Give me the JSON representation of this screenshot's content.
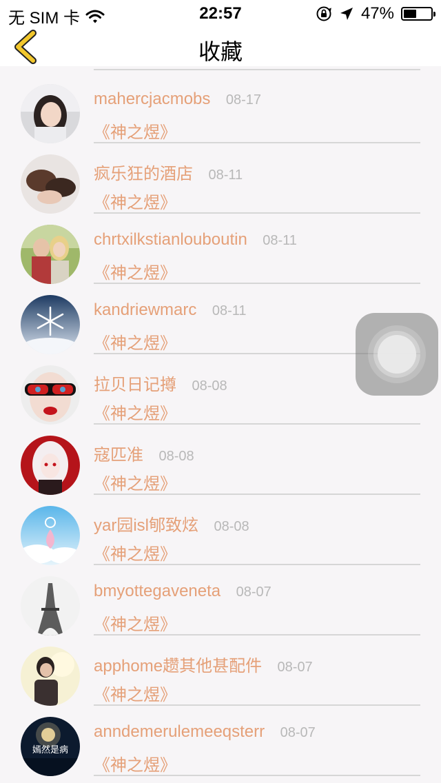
{
  "status_bar": {
    "carrier": "无 SIM 卡",
    "time": "22:57",
    "battery_text": "47%",
    "battery_level": 0.47,
    "icons": [
      "wifi-icon",
      "rotation-lock-icon",
      "location-arrow-icon",
      "battery-icon"
    ]
  },
  "nav": {
    "title": "收藏",
    "back_icon": "chevron-left-icon",
    "accent_color": "#f2c72c"
  },
  "colors": {
    "name": "#e5a078",
    "date": "#b8b8b8",
    "divider": "#d6d6d6",
    "background": "#f7f5f7"
  },
  "favorites": [
    {
      "name": "",
      "date": "",
      "book": ""
    },
    {
      "name": "mahercjacmobs",
      "date": "08-17",
      "book": "《神之煜》"
    },
    {
      "name": "疯乐狂的酒店",
      "date": "08-11",
      "book": "《神之煜》"
    },
    {
      "name": "chrtxilkstianlouboutin",
      "date": "08-11",
      "book": "《神之煜》"
    },
    {
      "name": "kandriewmarc",
      "date": "08-11",
      "book": "《神之煜》"
    },
    {
      "name": "拉贝日记撙",
      "date": "08-08",
      "book": "《神之煜》"
    },
    {
      "name": "寇匹准",
      "date": "08-08",
      "book": "《神之煜》"
    },
    {
      "name": "yar园isl郇致炫",
      "date": "08-08",
      "book": "《神之煜》"
    },
    {
      "name": "bmyottegaveneta",
      "date": "08-07",
      "book": "《神之煜》"
    },
    {
      "name": "apphome趱其他甚配件",
      "date": "08-07",
      "book": "《神之煜》"
    },
    {
      "name": "anndemerulemeeqsterr",
      "date": "08-07",
      "book": "《神之煜》"
    }
  ],
  "avatar_overlay_text": "嫣然是病",
  "assistive_touch": {
    "icon": "assistive-touch-icon"
  }
}
